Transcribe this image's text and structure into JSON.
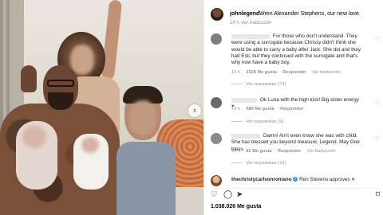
{
  "post": {
    "username": "johnlegend",
    "caption": "Wren Alexander Stephens, our new love.",
    "age": "14 h",
    "translate": "Ver traducción",
    "likes": "1.038.026 Me gusta"
  },
  "comments": [
    {
      "text": "For those who don't understand. They were using a surrogate because Chrissy didn't think she would be able to carry a baby after Jack. She did and they had Esti, but they continued with the surrogate and that's why now have a baby boy.",
      "age": "13 h",
      "likes": "2528 Me gusta",
      "reply": "Responder",
      "translate": "Ver traducción",
      "replies": "Ver respuestas (74)"
    },
    {
      "text": "Ok Luna with the high kick! Big sister energy",
      "age": "14 h",
      "likes": "589 Me gusta",
      "reply": "Responder",
      "replies": "Ver respuestas (6)"
    },
    {
      "text": "Damn! Ain't even know she was with child. She has blessed you beyond measure, Legend. May God bless.",
      "age": "14 h",
      "likes": "82 Me gusta",
      "reply": "Responder",
      "translate": "Ver traducción",
      "replies": "Ver respuestas (12)"
    },
    {
      "username": "thechristycarlsonromano",
      "text": "Ren Stevens approves"
    }
  ],
  "icons": {
    "like": "heart-icon",
    "comment": "comment-icon",
    "share": "share-icon",
    "save": "bookmark-icon",
    "next": "chevron-right-icon"
  },
  "colors": {
    "verified": "#3897f0",
    "meta_gray": "#8e8e8e",
    "purple_heart": "#7b4cc9",
    "red_heart": "#e0245e"
  }
}
